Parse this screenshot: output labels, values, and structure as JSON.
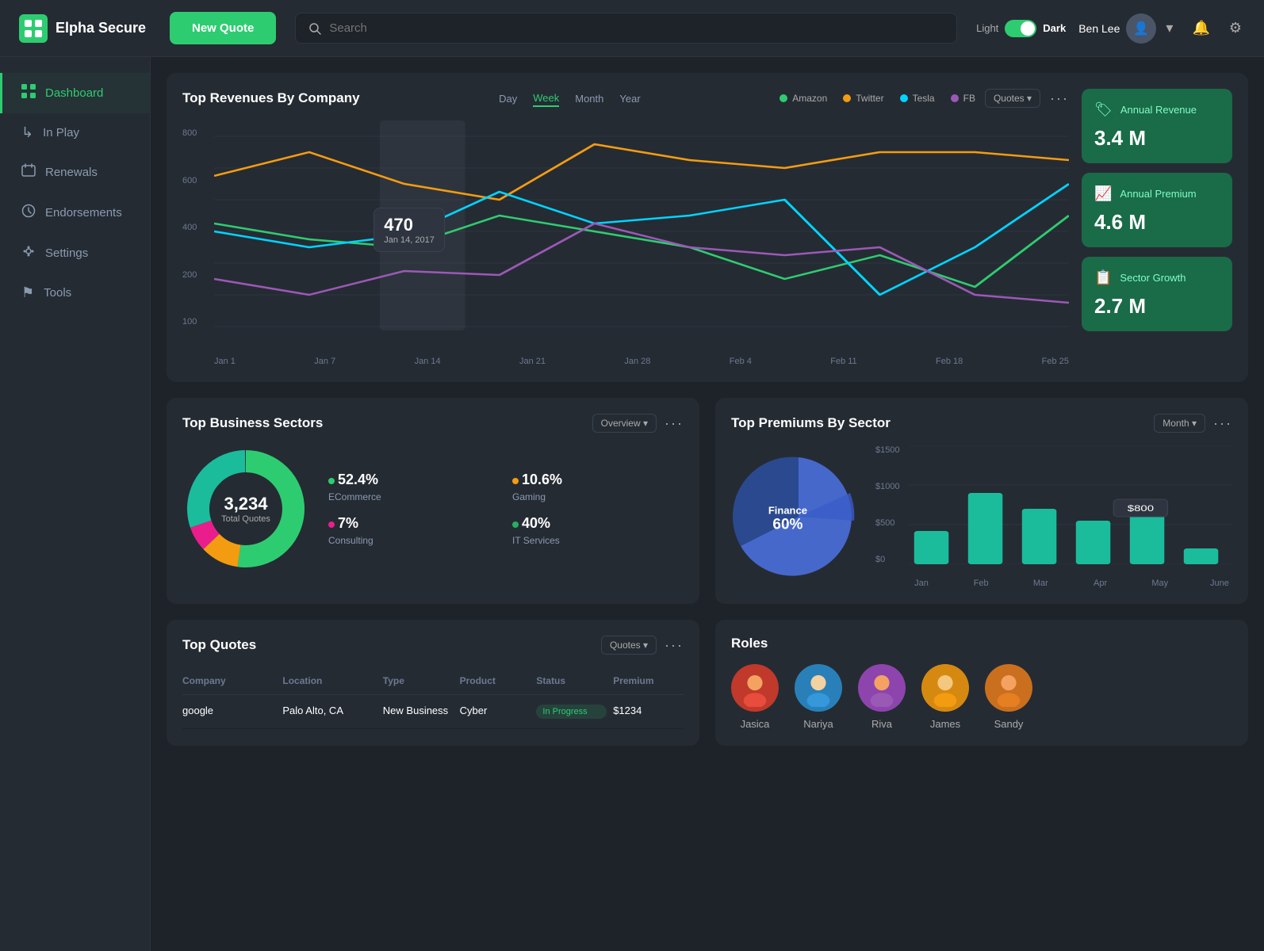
{
  "app": {
    "name": "Elpha Secure",
    "theme": {
      "light": "Light",
      "dark": "Dark"
    }
  },
  "header": {
    "new_quote_label": "New Quote",
    "search_placeholder": "Search",
    "user_name": "Ben Lee"
  },
  "sidebar": {
    "items": [
      {
        "id": "dashboard",
        "label": "Dashboard",
        "icon": "▦",
        "active": true
      },
      {
        "id": "in-play",
        "label": "In Play",
        "icon": "↳"
      },
      {
        "id": "renewals",
        "label": "Renewals",
        "icon": "📅"
      },
      {
        "id": "endorsements",
        "label": "Endorsements",
        "icon": "🕐"
      },
      {
        "id": "settings",
        "label": "Settings",
        "icon": "👤"
      },
      {
        "id": "tools",
        "label": "Tools",
        "icon": "⚑"
      }
    ]
  },
  "revenue_chart": {
    "title": "Top Revenues By Company",
    "dropdown": "Quotes",
    "periods": [
      "Day",
      "Week",
      "Month",
      "Year"
    ],
    "active_period": "Week",
    "legend": [
      {
        "name": "Amazon",
        "color": "#2ecc71"
      },
      {
        "name": "Twitter",
        "color": "#f39c12"
      },
      {
        "name": "Tesla",
        "color": "#00d4ff"
      },
      {
        "name": "FB",
        "color": "#9b59b6"
      }
    ],
    "y_labels": [
      "800",
      "600",
      "400",
      "200",
      "100"
    ],
    "x_labels": [
      "Jan 1",
      "Jan 7",
      "Jan 14",
      "Jan 21",
      "Jan 28",
      "Feb 4",
      "Feb 11",
      "Feb 18",
      "Feb 25"
    ],
    "tooltip": {
      "value": "470",
      "date": "Jan 14, 2017"
    }
  },
  "stat_cards": [
    {
      "id": "annual-revenue",
      "icon": "🏷",
      "label": "Annual Revenue",
      "value": "3.4 M"
    },
    {
      "id": "annual-premium",
      "icon": "📈",
      "label": "Annual Premium",
      "value": "4.6 M"
    },
    {
      "id": "sector-growth",
      "icon": "📋",
      "label": "Sector Growth",
      "value": "2.7 M"
    }
  ],
  "business_sectors": {
    "title": "Top Business Sectors",
    "dropdown": "Overview",
    "total": "3,234",
    "total_label": "Total Quotes",
    "sectors": [
      {
        "pct": "52.4%",
        "name": "ECommerce",
        "color": "#2ecc71"
      },
      {
        "pct": "10.6%",
        "name": "Gaming",
        "color": "#f39c12"
      },
      {
        "pct": "7%",
        "name": "Consulting",
        "color": "#e91e8c"
      },
      {
        "pct": "40%",
        "name": "IT Services",
        "color": "#27ae60"
      }
    ]
  },
  "top_premiums": {
    "title": "Top Premiums By Sector",
    "dropdown": "Month",
    "pie_label": "Finance",
    "pie_pct": "60%",
    "y_labels": [
      "$1500",
      "$1000",
      "$500",
      "$0"
    ],
    "x_labels": [
      "Jan",
      "Feb",
      "Mar",
      "Apr",
      "May",
      "June"
    ],
    "bar_values": [
      420,
      900,
      700,
      550,
      620,
      200
    ],
    "tooltip_val": "$800",
    "tooltip_month": "May"
  },
  "top_quotes": {
    "title": "Top Quotes",
    "dropdown": "Quotes",
    "columns": [
      "Company",
      "Location",
      "Type",
      "Product",
      "Status",
      "Premium"
    ],
    "rows": [
      {
        "company": "google",
        "location": "Palo Alto, CA",
        "type": "New Business",
        "product": "Cyber",
        "status": "In Progress",
        "premium": "$1234"
      }
    ]
  },
  "roles": {
    "title": "Roles",
    "people": [
      {
        "name": "Jasica",
        "color": "#e74c3c",
        "emoji": "👩"
      },
      {
        "name": "Nariya",
        "color": "#3498db",
        "emoji": "👱"
      },
      {
        "name": "Riva",
        "color": "#9b59b6",
        "emoji": "👩"
      },
      {
        "name": "James",
        "color": "#f39c12",
        "emoji": "🧔"
      },
      {
        "name": "Sandy",
        "color": "#e67e22",
        "emoji": "👩"
      }
    ]
  }
}
